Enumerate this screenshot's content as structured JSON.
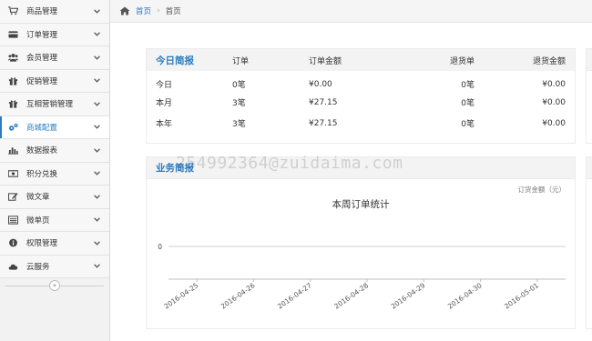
{
  "sidebar": {
    "items": [
      {
        "label": "商品管理",
        "icon": "cart-icon",
        "active": false
      },
      {
        "label": "订单管理",
        "icon": "card-icon",
        "active": false
      },
      {
        "label": "会员管理",
        "icon": "users-icon",
        "active": false
      },
      {
        "label": "促销管理",
        "icon": "gift-icon",
        "active": false
      },
      {
        "label": "互相营销管理",
        "icon": "gift-icon",
        "active": false
      },
      {
        "label": "商城配置",
        "icon": "cogs-icon",
        "active": true
      },
      {
        "label": "数据报表",
        "icon": "bar-chart-icon",
        "active": false
      },
      {
        "label": "积分兑换",
        "icon": "money-icon",
        "active": false
      },
      {
        "label": "微文章",
        "icon": "edit-icon",
        "active": false
      },
      {
        "label": "微单页",
        "icon": "list-card-icon",
        "active": false
      },
      {
        "label": "权限管理",
        "icon": "info-icon",
        "active": false
      },
      {
        "label": "云服务",
        "icon": "cloud-icon",
        "active": false
      }
    ],
    "collapse_glyph": "«"
  },
  "breadcrumb": {
    "home_label": "首页",
    "separator": "›",
    "current": "首页"
  },
  "summary": {
    "title": "今日简报",
    "columns": [
      "订单",
      "订单金额",
      "退货单",
      "退货金额"
    ],
    "rows": [
      {
        "period": "今日",
        "orders": "0笔",
        "amount": "¥0.00",
        "returns": "0笔",
        "refund": "¥0.00"
      },
      {
        "period": "本月",
        "orders": "3笔",
        "amount": "¥27.15",
        "returns": "0笔",
        "refund": "¥0.00"
      },
      {
        "period": "本年",
        "orders": "3笔",
        "amount": "¥27.15",
        "returns": "0笔",
        "refund": "¥0.00"
      }
    ]
  },
  "business": {
    "title": "业务简报",
    "chart_note": "订货金额（元）"
  },
  "chart_data": {
    "type": "line",
    "title": "本周订单统计",
    "categories": [
      "2016-04-25",
      "2016-04-26",
      "2016-04-27",
      "2016-04-28",
      "2016-04-29",
      "2016-04-30",
      "2016-05-01"
    ],
    "series": [
      {
        "values": [
          0,
          0,
          0,
          0,
          0,
          0,
          0
        ]
      }
    ],
    "y_ticks": [
      "0"
    ],
    "grid": true
  },
  "watermark": "254992364@zuidaima.com",
  "colors": {
    "accent": "#2d7cc1",
    "panel_header": "#f3f3f3",
    "sidebar": "#f2f2f2"
  }
}
